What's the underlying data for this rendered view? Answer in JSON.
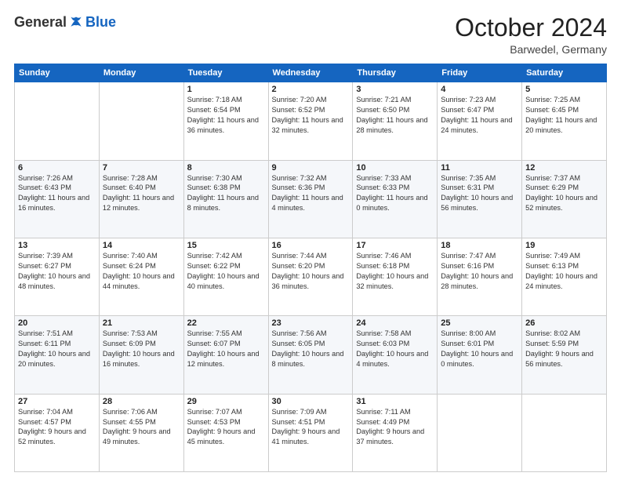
{
  "header": {
    "logo_general": "General",
    "logo_blue": "Blue",
    "month_title": "October 2024",
    "location": "Barwedel, Germany"
  },
  "weekdays": [
    "Sunday",
    "Monday",
    "Tuesday",
    "Wednesday",
    "Thursday",
    "Friday",
    "Saturday"
  ],
  "weeks": [
    [
      {
        "day": "",
        "sunrise": "",
        "sunset": "",
        "daylight": ""
      },
      {
        "day": "",
        "sunrise": "",
        "sunset": "",
        "daylight": ""
      },
      {
        "day": "1",
        "sunrise": "Sunrise: 7:18 AM",
        "sunset": "Sunset: 6:54 PM",
        "daylight": "Daylight: 11 hours and 36 minutes."
      },
      {
        "day": "2",
        "sunrise": "Sunrise: 7:20 AM",
        "sunset": "Sunset: 6:52 PM",
        "daylight": "Daylight: 11 hours and 32 minutes."
      },
      {
        "day": "3",
        "sunrise": "Sunrise: 7:21 AM",
        "sunset": "Sunset: 6:50 PM",
        "daylight": "Daylight: 11 hours and 28 minutes."
      },
      {
        "day": "4",
        "sunrise": "Sunrise: 7:23 AM",
        "sunset": "Sunset: 6:47 PM",
        "daylight": "Daylight: 11 hours and 24 minutes."
      },
      {
        "day": "5",
        "sunrise": "Sunrise: 7:25 AM",
        "sunset": "Sunset: 6:45 PM",
        "daylight": "Daylight: 11 hours and 20 minutes."
      }
    ],
    [
      {
        "day": "6",
        "sunrise": "Sunrise: 7:26 AM",
        "sunset": "Sunset: 6:43 PM",
        "daylight": "Daylight: 11 hours and 16 minutes."
      },
      {
        "day": "7",
        "sunrise": "Sunrise: 7:28 AM",
        "sunset": "Sunset: 6:40 PM",
        "daylight": "Daylight: 11 hours and 12 minutes."
      },
      {
        "day": "8",
        "sunrise": "Sunrise: 7:30 AM",
        "sunset": "Sunset: 6:38 PM",
        "daylight": "Daylight: 11 hours and 8 minutes."
      },
      {
        "day": "9",
        "sunrise": "Sunrise: 7:32 AM",
        "sunset": "Sunset: 6:36 PM",
        "daylight": "Daylight: 11 hours and 4 minutes."
      },
      {
        "day": "10",
        "sunrise": "Sunrise: 7:33 AM",
        "sunset": "Sunset: 6:33 PM",
        "daylight": "Daylight: 11 hours and 0 minutes."
      },
      {
        "day": "11",
        "sunrise": "Sunrise: 7:35 AM",
        "sunset": "Sunset: 6:31 PM",
        "daylight": "Daylight: 10 hours and 56 minutes."
      },
      {
        "day": "12",
        "sunrise": "Sunrise: 7:37 AM",
        "sunset": "Sunset: 6:29 PM",
        "daylight": "Daylight: 10 hours and 52 minutes."
      }
    ],
    [
      {
        "day": "13",
        "sunrise": "Sunrise: 7:39 AM",
        "sunset": "Sunset: 6:27 PM",
        "daylight": "Daylight: 10 hours and 48 minutes."
      },
      {
        "day": "14",
        "sunrise": "Sunrise: 7:40 AM",
        "sunset": "Sunset: 6:24 PM",
        "daylight": "Daylight: 10 hours and 44 minutes."
      },
      {
        "day": "15",
        "sunrise": "Sunrise: 7:42 AM",
        "sunset": "Sunset: 6:22 PM",
        "daylight": "Daylight: 10 hours and 40 minutes."
      },
      {
        "day": "16",
        "sunrise": "Sunrise: 7:44 AM",
        "sunset": "Sunset: 6:20 PM",
        "daylight": "Daylight: 10 hours and 36 minutes."
      },
      {
        "day": "17",
        "sunrise": "Sunrise: 7:46 AM",
        "sunset": "Sunset: 6:18 PM",
        "daylight": "Daylight: 10 hours and 32 minutes."
      },
      {
        "day": "18",
        "sunrise": "Sunrise: 7:47 AM",
        "sunset": "Sunset: 6:16 PM",
        "daylight": "Daylight: 10 hours and 28 minutes."
      },
      {
        "day": "19",
        "sunrise": "Sunrise: 7:49 AM",
        "sunset": "Sunset: 6:13 PM",
        "daylight": "Daylight: 10 hours and 24 minutes."
      }
    ],
    [
      {
        "day": "20",
        "sunrise": "Sunrise: 7:51 AM",
        "sunset": "Sunset: 6:11 PM",
        "daylight": "Daylight: 10 hours and 20 minutes."
      },
      {
        "day": "21",
        "sunrise": "Sunrise: 7:53 AM",
        "sunset": "Sunset: 6:09 PM",
        "daylight": "Daylight: 10 hours and 16 minutes."
      },
      {
        "day": "22",
        "sunrise": "Sunrise: 7:55 AM",
        "sunset": "Sunset: 6:07 PM",
        "daylight": "Daylight: 10 hours and 12 minutes."
      },
      {
        "day": "23",
        "sunrise": "Sunrise: 7:56 AM",
        "sunset": "Sunset: 6:05 PM",
        "daylight": "Daylight: 10 hours and 8 minutes."
      },
      {
        "day": "24",
        "sunrise": "Sunrise: 7:58 AM",
        "sunset": "Sunset: 6:03 PM",
        "daylight": "Daylight: 10 hours and 4 minutes."
      },
      {
        "day": "25",
        "sunrise": "Sunrise: 8:00 AM",
        "sunset": "Sunset: 6:01 PM",
        "daylight": "Daylight: 10 hours and 0 minutes."
      },
      {
        "day": "26",
        "sunrise": "Sunrise: 8:02 AM",
        "sunset": "Sunset: 5:59 PM",
        "daylight": "Daylight: 9 hours and 56 minutes."
      }
    ],
    [
      {
        "day": "27",
        "sunrise": "Sunrise: 7:04 AM",
        "sunset": "Sunset: 4:57 PM",
        "daylight": "Daylight: 9 hours and 52 minutes."
      },
      {
        "day": "28",
        "sunrise": "Sunrise: 7:06 AM",
        "sunset": "Sunset: 4:55 PM",
        "daylight": "Daylight: 9 hours and 49 minutes."
      },
      {
        "day": "29",
        "sunrise": "Sunrise: 7:07 AM",
        "sunset": "Sunset: 4:53 PM",
        "daylight": "Daylight: 9 hours and 45 minutes."
      },
      {
        "day": "30",
        "sunrise": "Sunrise: 7:09 AM",
        "sunset": "Sunset: 4:51 PM",
        "daylight": "Daylight: 9 hours and 41 minutes."
      },
      {
        "day": "31",
        "sunrise": "Sunrise: 7:11 AM",
        "sunset": "Sunset: 4:49 PM",
        "daylight": "Daylight: 9 hours and 37 minutes."
      },
      {
        "day": "",
        "sunrise": "",
        "sunset": "",
        "daylight": ""
      },
      {
        "day": "",
        "sunrise": "",
        "sunset": "",
        "daylight": ""
      }
    ]
  ]
}
